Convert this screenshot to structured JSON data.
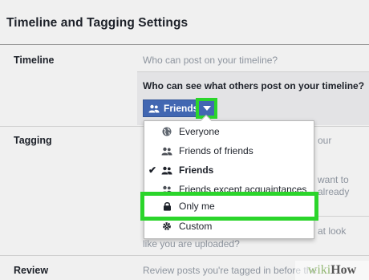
{
  "page_title": "Timeline and Tagging Settings",
  "sections": {
    "timeline": {
      "label": "Timeline",
      "who_can_post": "Who can post on your timeline?",
      "who_can_see": "Who can see what others post on your timeline?",
      "privacy_button_label": "Friends"
    },
    "tagging": {
      "label": "Tagging",
      "partial_texts": [
        "our",
        "want to",
        "already",
        "at look"
      ],
      "like_uploaded": "like you are uploaded?"
    },
    "review": {
      "label": "Review",
      "text": "Review posts you're tagged in before the"
    }
  },
  "audience_menu": {
    "items": [
      {
        "label": "Everyone",
        "icon": "globe-icon",
        "checked": false
      },
      {
        "label": "Friends of friends",
        "icon": "friends-icon",
        "checked": false
      },
      {
        "label": "Friends",
        "icon": "friends-icon",
        "checked": true
      },
      {
        "label": "Friends except acquaintances",
        "icon": "friends-icon",
        "checked": false
      },
      {
        "label": "Only me",
        "icon": "lock-icon",
        "checked": false
      },
      {
        "label": "Custom",
        "icon": "gear-icon",
        "checked": false
      }
    ]
  },
  "colors": {
    "highlight": "#2bd52b",
    "facebook_blue": "#4267b2"
  },
  "watermark": {
    "wiki": "wiki",
    "how": "How"
  }
}
